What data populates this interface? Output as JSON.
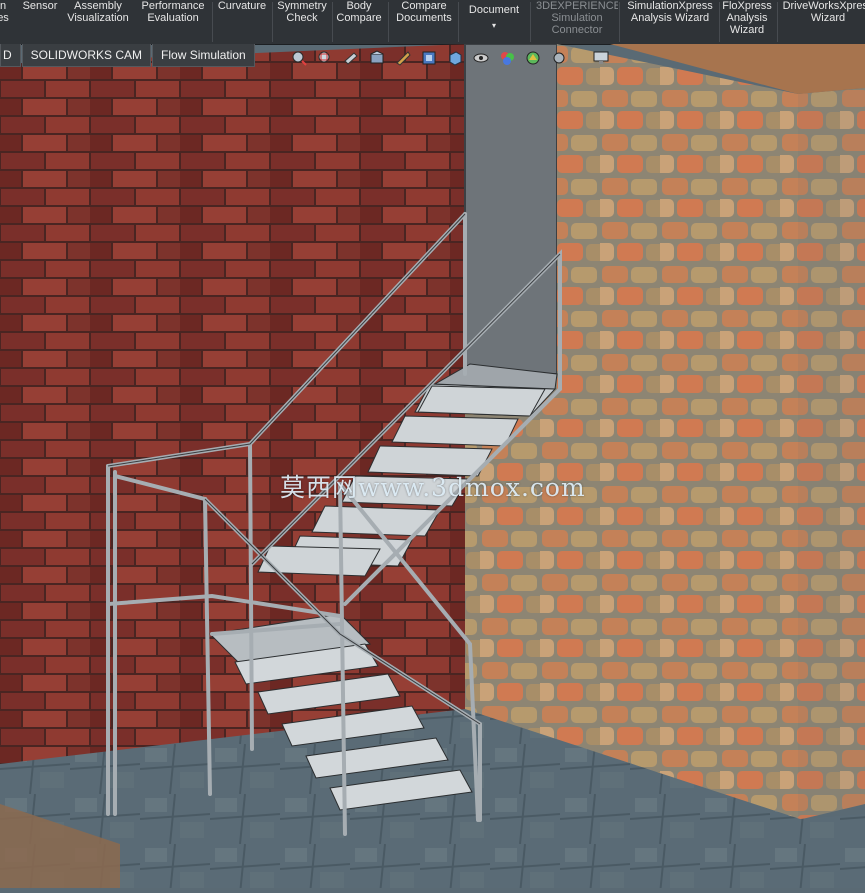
{
  "ribbon": {
    "buttons": [
      {
        "id": "partial-left",
        "lines": [
          "n",
          "es"
        ]
      },
      {
        "id": "sensor",
        "lines": [
          "Sensor"
        ]
      },
      {
        "id": "assembly-visualization",
        "lines": [
          "Assembly",
          "Visualization"
        ]
      },
      {
        "id": "performance-evaluation",
        "lines": [
          "Performance",
          "Evaluation"
        ]
      },
      {
        "id": "curvature",
        "lines": [
          "Curvature"
        ]
      },
      {
        "id": "symmetry-check",
        "lines": [
          "Symmetry",
          "Check"
        ]
      },
      {
        "id": "body-compare",
        "lines": [
          "Body",
          "Compare"
        ]
      },
      {
        "id": "compare-documents",
        "lines": [
          "Compare",
          "Documents"
        ]
      },
      {
        "id": "document",
        "lines": [
          "Document"
        ],
        "dropdown": "▾"
      },
      {
        "id": "3dexperience-simulation-connector",
        "lines": [
          "3DEXPERIENCE",
          "Simulation",
          "Connector"
        ],
        "disabled": true
      },
      {
        "id": "simulationxpress-analysis-wizard",
        "lines": [
          "SimulationXpress",
          "Analysis Wizard"
        ]
      },
      {
        "id": "floxpress-analysis-wizard",
        "lines": [
          "FloXpress",
          "Analysis",
          "Wizard"
        ]
      },
      {
        "id": "driveworksxpress-wizard",
        "lines": [
          "DriveWorksXpress",
          "Wizard"
        ]
      }
    ]
  },
  "tabs": [
    {
      "label": "D"
    },
    {
      "label": "SOLIDWORKS CAM"
    },
    {
      "label": "Flow Simulation"
    }
  ],
  "view_toolbar": {
    "icons": [
      "zoom-to-fit-icon",
      "zoom-to-area-icon",
      "previous-view-icon",
      "section-view-icon",
      "view-orientation-icon",
      "display-style-icon",
      "view-cube-icon",
      "hide-show-items-icon",
      "edit-appearance-icon",
      "apply-scene-icon",
      "view-settings-icon",
      "monitor-icon"
    ]
  },
  "watermark": "莫西网www.3dmox.com",
  "colors": {
    "ribbon_bg": "#2f3337",
    "tab_bg": "#3a3e42",
    "brick_dark": "#6a2a25",
    "stone_wall": "#b97a54",
    "floor": "#5d6f7a",
    "steel": "#9aa2a8"
  }
}
